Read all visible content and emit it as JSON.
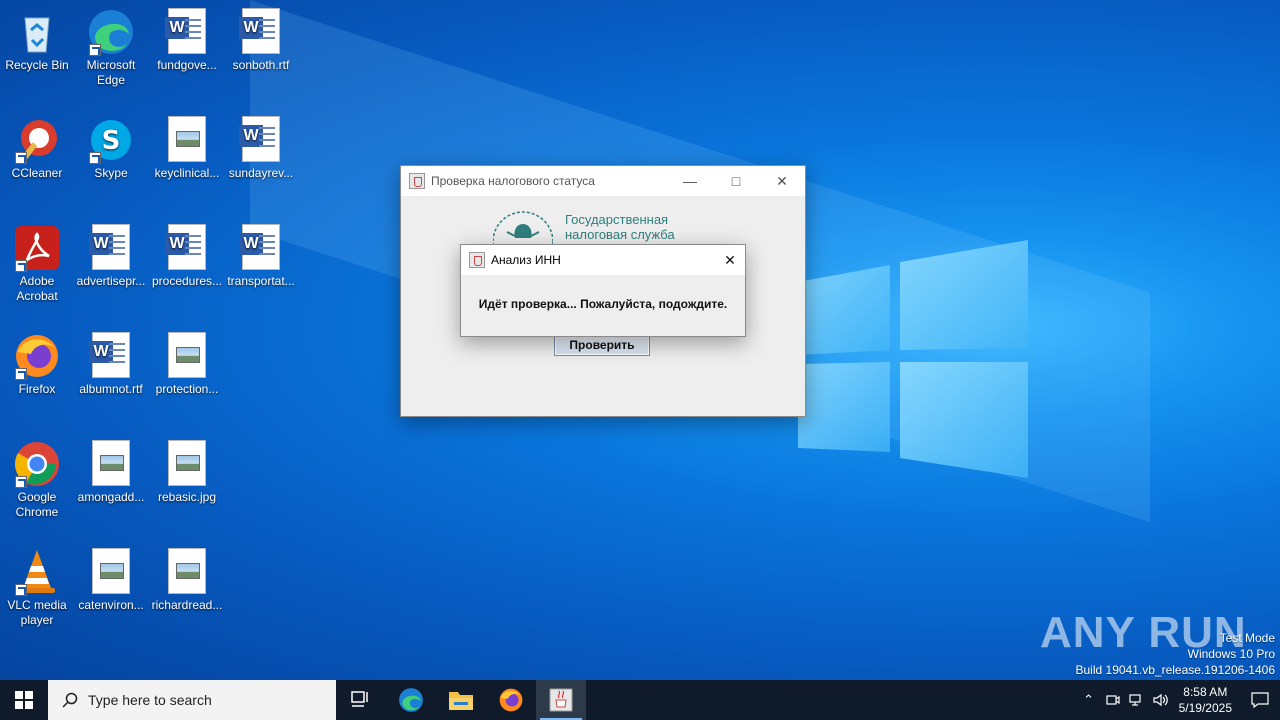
{
  "desktop": {
    "icons": [
      {
        "label": "Recycle Bin"
      },
      {
        "label": "Microsoft Edge"
      },
      {
        "label": "fundgove..."
      },
      {
        "label": "sonboth.rtf"
      },
      {
        "label": "CCleaner"
      },
      {
        "label": "Skype"
      },
      {
        "label": "keyclinical..."
      },
      {
        "label": "sundayrev..."
      },
      {
        "label": "Adobe Acrobat"
      },
      {
        "label": "advertisepr..."
      },
      {
        "label": "procedures..."
      },
      {
        "label": "transportat..."
      },
      {
        "label": "Firefox"
      },
      {
        "label": "albumnot.rtf"
      },
      {
        "label": "protection..."
      },
      {
        "label": "Google Chrome"
      },
      {
        "label": "amongadd..."
      },
      {
        "label": "rebasic.jpg"
      },
      {
        "label": "VLC media player"
      },
      {
        "label": "catenviron..."
      },
      {
        "label": "richardread..."
      }
    ]
  },
  "main_window": {
    "title": "Проверка налогового статуса",
    "org_line1": "Государственная",
    "org_line2": "налоговая служба",
    "check_button": "Проверить"
  },
  "dialog": {
    "title": "Анализ ИНН",
    "message": "Идёт проверка... Пожалуйста, подождите."
  },
  "watermark": {
    "brand": "ANY RUN",
    "line1": "Test Mode",
    "line2": "Windows 10 Pro",
    "line3": "Build 19041.vb_release.191206-1406"
  },
  "taskbar": {
    "search_placeholder": "Type here to search",
    "time": "8:58 AM",
    "date": "5/19/2025"
  }
}
